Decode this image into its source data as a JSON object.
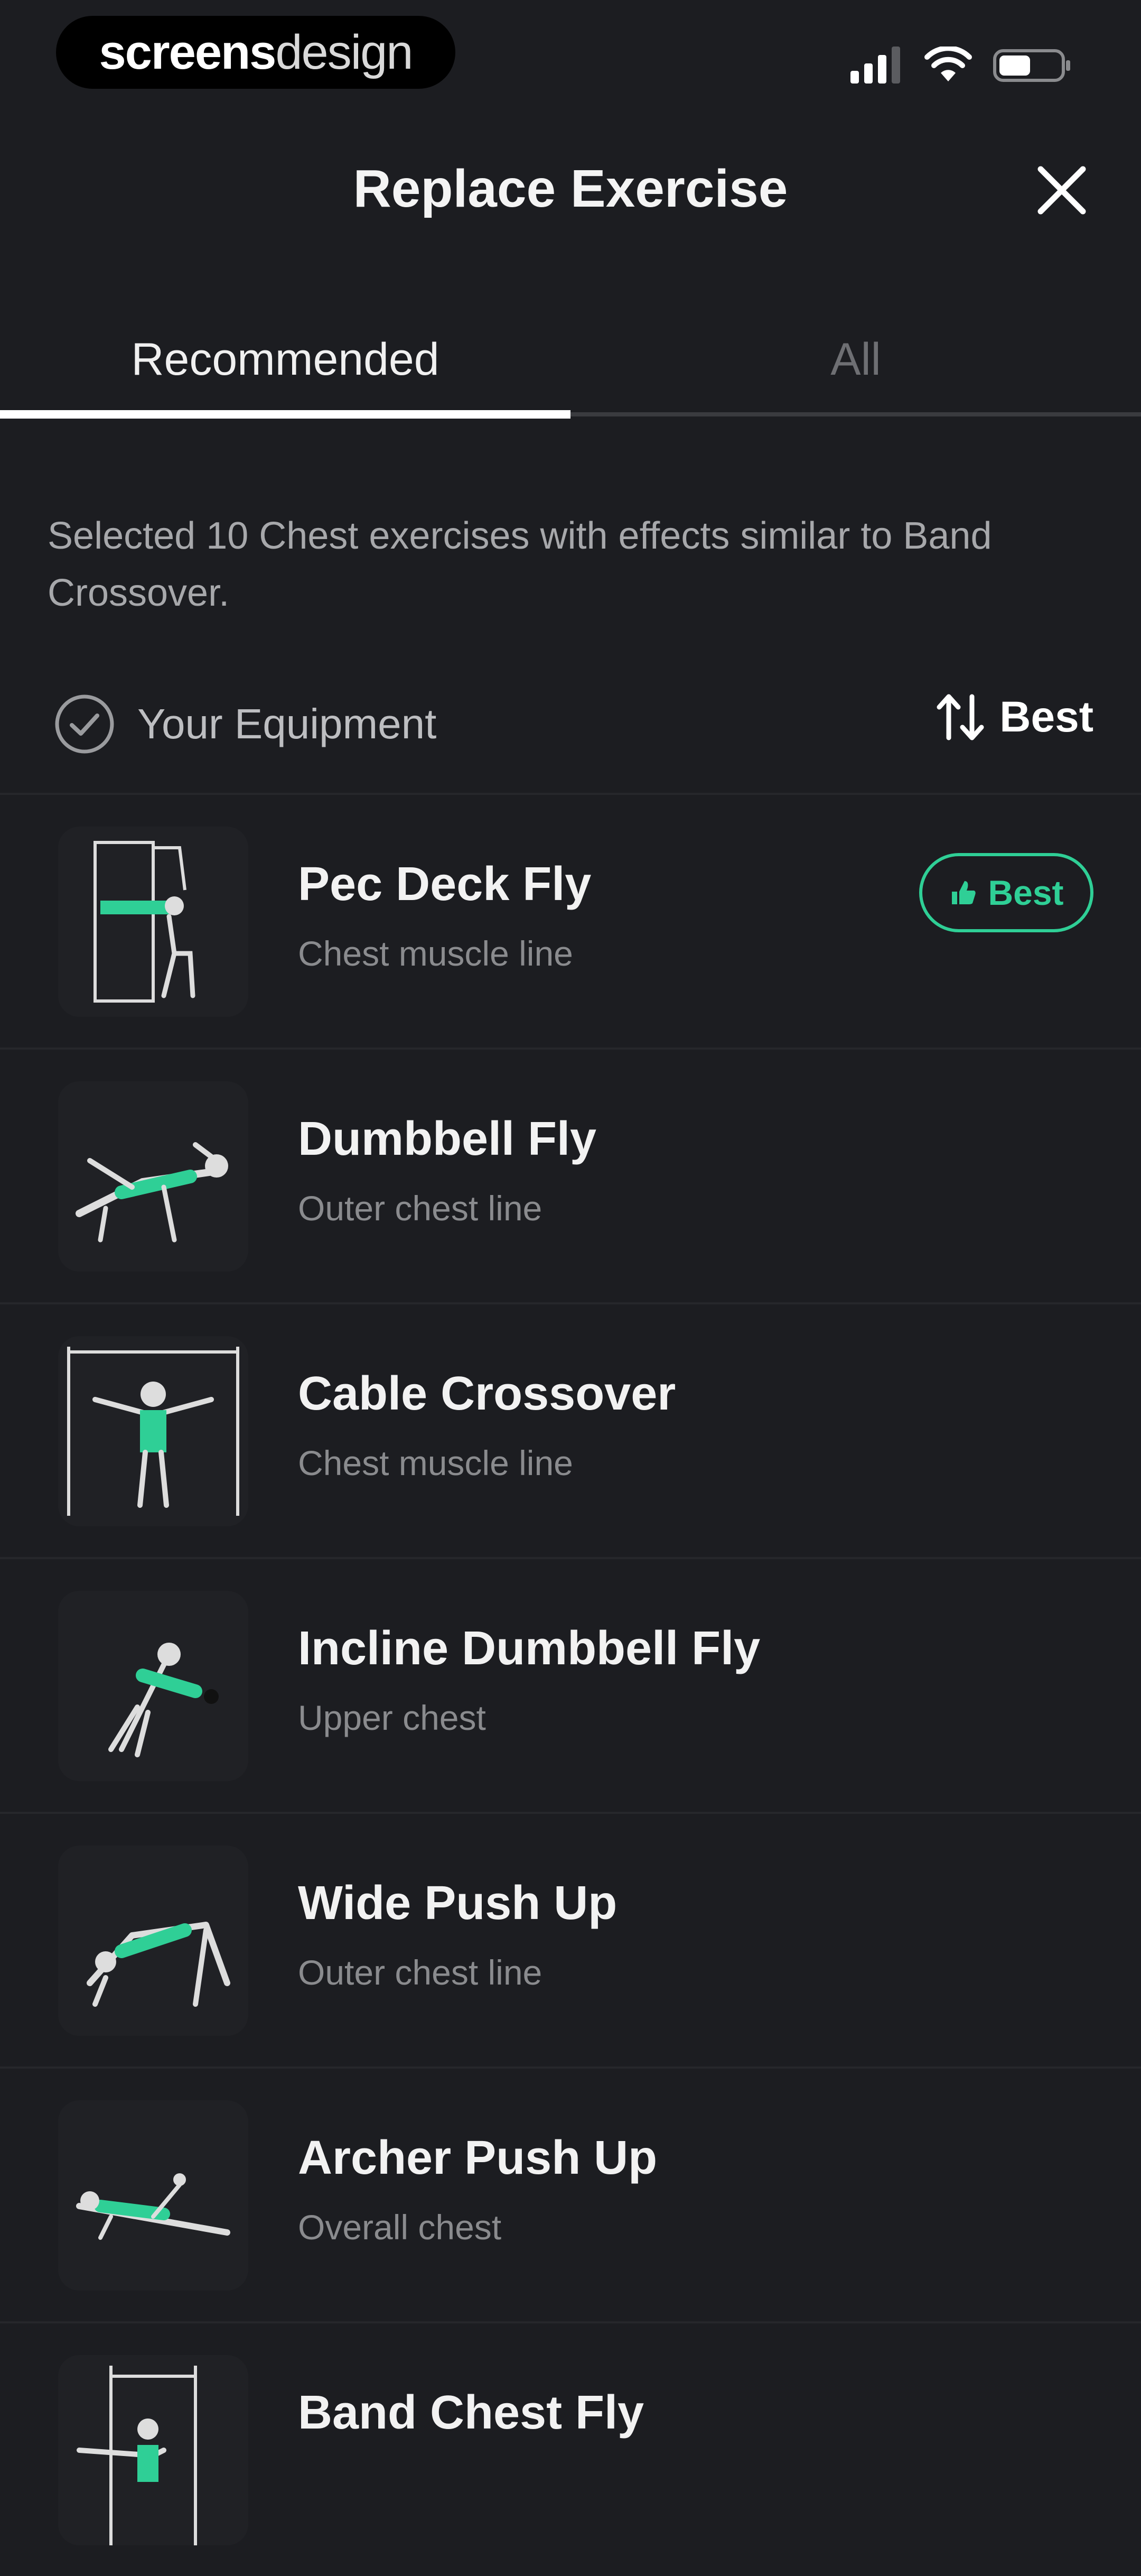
{
  "status_bar": {
    "brand_primary": "screens",
    "brand_secondary": "design"
  },
  "header": {
    "title": "Replace Exercise",
    "close_icon": "close-icon"
  },
  "tabs": [
    {
      "label": "Recommended",
      "active": true
    },
    {
      "label": "All",
      "active": false
    }
  ],
  "description": "Selected 10 Chest exercises with effects similar to Band Crossover.",
  "filter": {
    "equipment_label": "Your Equipment",
    "sort_label": "Best"
  },
  "exercises": [
    {
      "name": "Pec Deck Fly",
      "subtitle": "Chest muscle line",
      "badge": "Best"
    },
    {
      "name": "Dumbbell Fly",
      "subtitle": "Outer chest line"
    },
    {
      "name": "Cable Crossover",
      "subtitle": "Chest muscle line"
    },
    {
      "name": "Incline Dumbbell Fly",
      "subtitle": "Upper chest"
    },
    {
      "name": "Wide Push Up",
      "subtitle": "Outer chest line"
    },
    {
      "name": "Archer Push Up",
      "subtitle": "Overall chest"
    },
    {
      "name": "Band Chest Fly",
      "subtitle": ""
    }
  ],
  "colors": {
    "background": "#1c1d21",
    "accent": "#2fcf96"
  }
}
